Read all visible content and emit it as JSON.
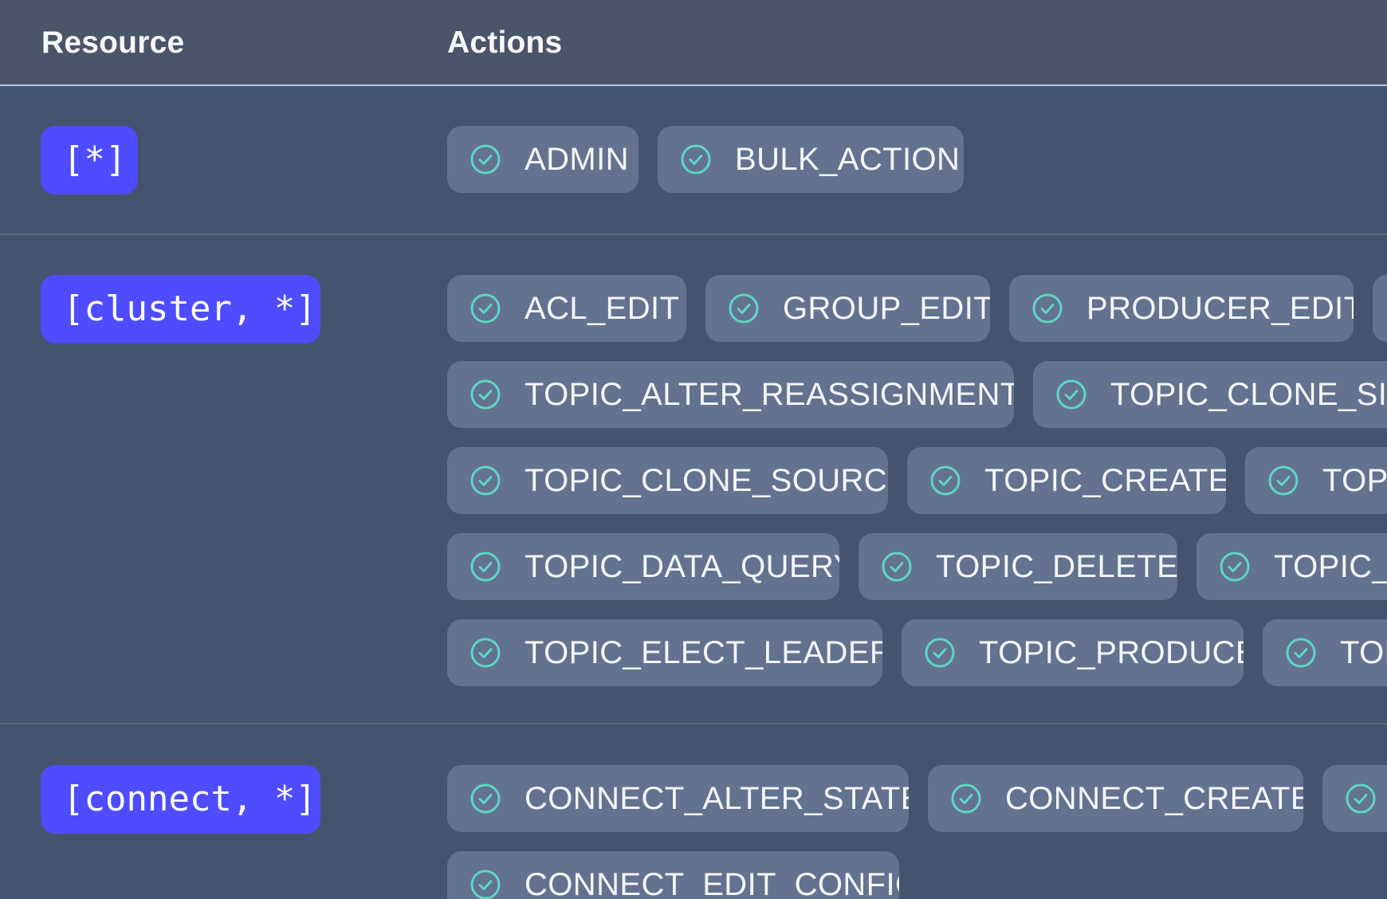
{
  "table": {
    "header": {
      "resource": "Resource",
      "actions": "Actions"
    },
    "rows": [
      {
        "resource": "[*]",
        "actions": [
          "ADMIN",
          "BULK_ACTION"
        ]
      },
      {
        "resource": "[cluster, *]",
        "actions": [
          "ACL_EDIT",
          "GROUP_EDIT",
          "PRODUCER_EDIT",
          "TOPIC_ALTER_REASSIGNMENTS",
          "TOPIC_CLONE_SINI",
          "TOPIC_CLONE_SOURCE",
          "TOPIC_CREATE",
          "TOPI",
          "TOPIC_DATA_QUERY",
          "TOPIC_DELETE",
          "TOPIC_E",
          "TOPIC_ELECT_LEADER",
          "TOPIC_PRODUCE",
          "TOF"
        ]
      },
      {
        "resource": "[connect, *]",
        "actions": [
          "CONNECT_ALTER_STATE",
          "CONNECT_CREATE",
          "",
          "CONNECT_EDIT_CONFIG"
        ]
      }
    ]
  },
  "colors": {
    "page_background": "#44546e",
    "header_background": "#4a5569",
    "resource_badge": "#4f4cff",
    "action_chip": "#63728e",
    "check_icon": "#5ed6c5",
    "header_divider": "#b7c6e4"
  },
  "icons": {
    "action_status": "check-circle-icon"
  }
}
